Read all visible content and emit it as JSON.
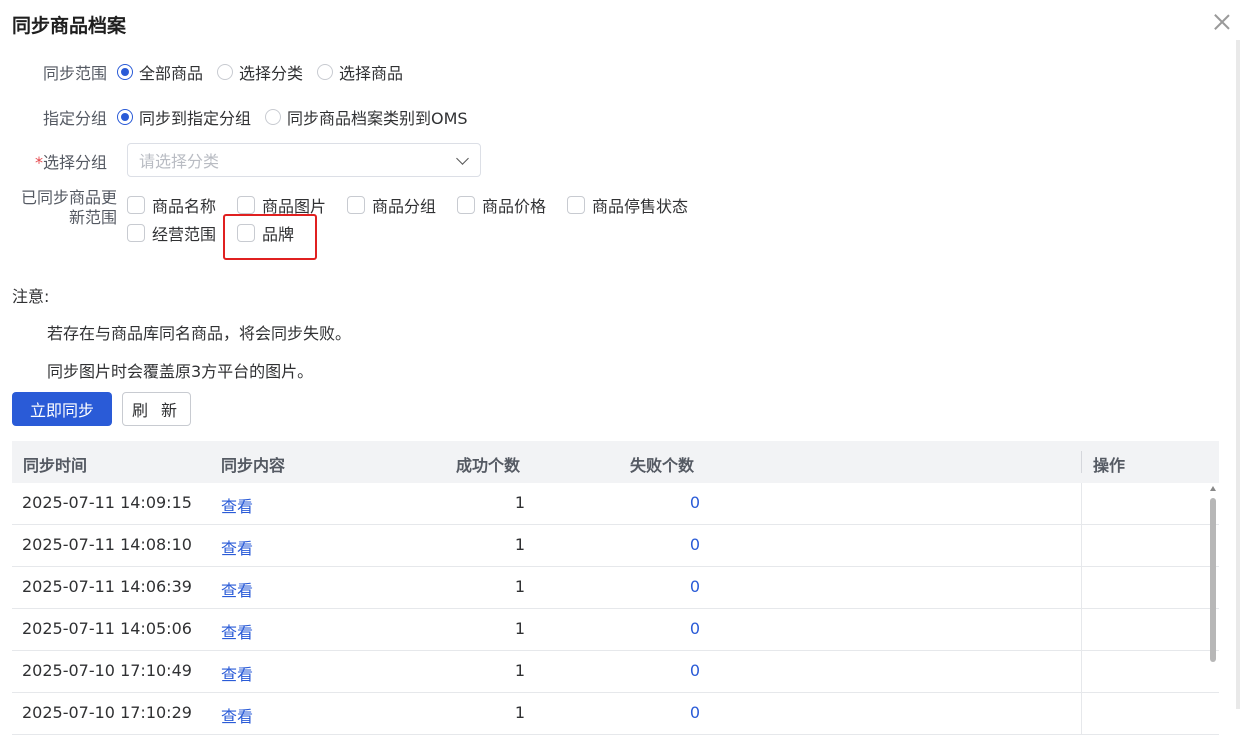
{
  "dialog": {
    "title": "同步商品档案"
  },
  "sync_scope": {
    "label": "同步范围",
    "options": [
      {
        "text": "全部商品",
        "checked": true
      },
      {
        "text": "选择分类",
        "checked": false
      },
      {
        "text": "选择商品",
        "checked": false
      }
    ]
  },
  "group": {
    "label": "指定分组",
    "options": [
      {
        "text": "同步到指定分组",
        "checked": true
      },
      {
        "text": "同步商品档案类别到OMS",
        "checked": false
      }
    ]
  },
  "select_group": {
    "required_mark": "*",
    "label": "选择分组",
    "placeholder": "请选择分类"
  },
  "update_scope": {
    "label_line1": "已同步商品更",
    "label_line2": "新范围",
    "options": [
      "商品名称",
      "商品图片",
      "商品分组",
      "商品价格",
      "商品停售状态",
      "经营范围",
      "品牌"
    ]
  },
  "notes": {
    "heading": "注意:",
    "line1": "若存在与商品库同名商品，将会同步失败。",
    "line2": "同步图片时会覆盖原3方平台的图片。"
  },
  "buttons": {
    "sync_now": "立即同步",
    "refresh": "刷 新"
  },
  "table": {
    "headers": [
      "同步时间",
      "同步内容",
      "成功个数",
      "失败个数",
      "操作"
    ],
    "rows": [
      {
        "time": "2025-07-11 14:09:15",
        "content": "查看",
        "success": "1",
        "fail": "0"
      },
      {
        "time": "2025-07-11 14:08:10",
        "content": "查看",
        "success": "1",
        "fail": "0"
      },
      {
        "time": "2025-07-11 14:06:39",
        "content": "查看",
        "success": "1",
        "fail": "0"
      },
      {
        "time": "2025-07-11 14:05:06",
        "content": "查看",
        "success": "1",
        "fail": "0"
      },
      {
        "time": "2025-07-10 17:10:49",
        "content": "查看",
        "success": "1",
        "fail": "0"
      },
      {
        "time": "2025-07-10 17:10:29",
        "content": "查看",
        "success": "1",
        "fail": "0"
      }
    ]
  },
  "colors": {
    "primary": "#2a5bd7",
    "highlight": "#e02020",
    "required": "#e5484d"
  }
}
